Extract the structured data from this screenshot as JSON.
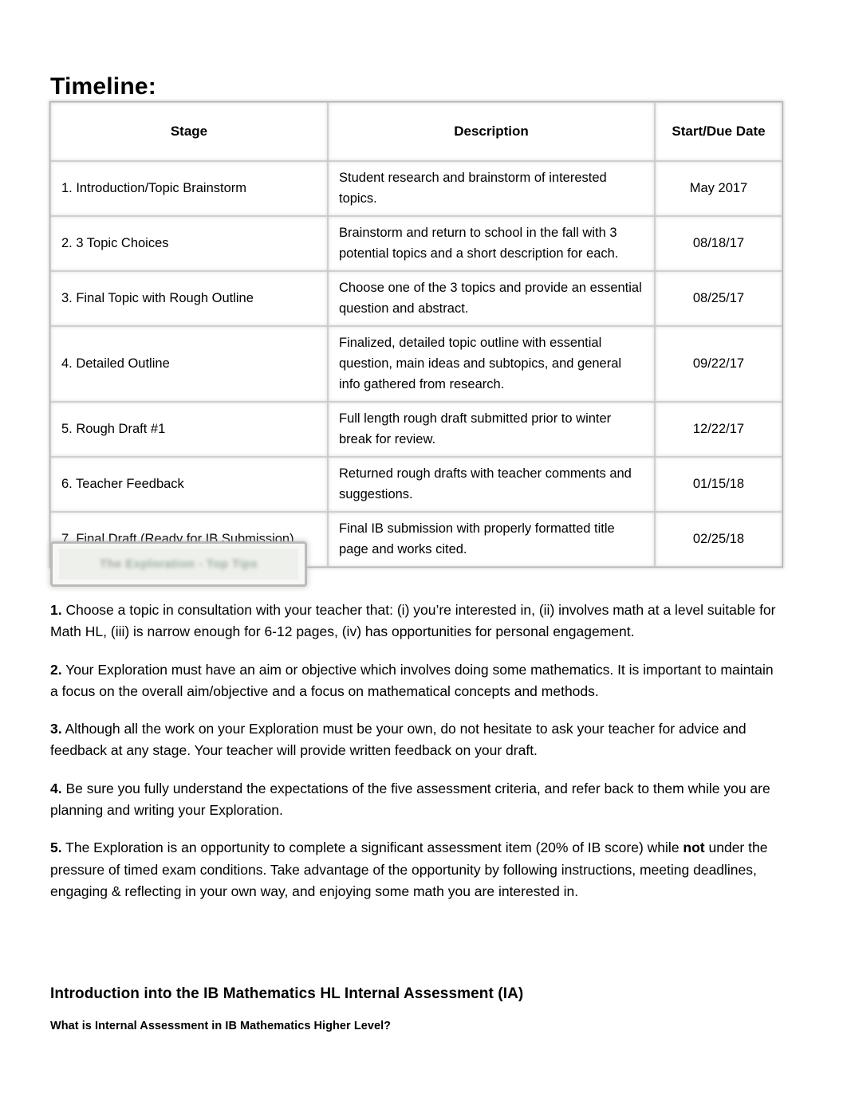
{
  "document": {
    "title": "Timeline:"
  },
  "timeline_table": {
    "headers": [
      "Stage",
      "Description",
      "Start/Due Date"
    ],
    "rows": [
      {
        "stage": "1. Introduction/Topic Brainstorm",
        "description": "Student research and brainstorm of interested topics.",
        "date": "May 2017"
      },
      {
        "stage": "2. 3 Topic Choices",
        "description": "Brainstorm and return to school in the fall with 3 potential topics and a short description for each.",
        "date": "08/18/17"
      },
      {
        "stage": "3. Final Topic with Rough Outline",
        "description": "Choose one of the 3 topics and provide an essential question and abstract.",
        "date": "08/25/17"
      },
      {
        "stage": "4. Detailed Outline",
        "description": "Finalized, detailed topic outline with essential question, main ideas and subtopics, and general info gathered from research.",
        "date": "09/22/17"
      },
      {
        "stage": "5. Rough Draft #1",
        "description": "Full length rough draft submitted prior to winter break for review.",
        "date": "12/22/17"
      },
      {
        "stage": "6. Teacher Feedback",
        "description": "Returned rough drafts with teacher comments and suggestions.",
        "date": "01/15/18"
      },
      {
        "stage": "7. Final Draft (Ready for IB Submission)",
        "description": "Final IB submission with properly formatted title page and works cited.",
        "date": "02/25/18"
      }
    ]
  },
  "tip_banner": {
    "text": "The Exploration - Top Tips",
    "text_color": "#8fa08d",
    "border_color": "#b9bcb9",
    "background_color": "#eef0ec"
  },
  "tips": [
    {
      "number": "1.",
      "parts": [
        {
          "text": " Choose a topic in consultation with your teacher that: (i) you’re interested in, (ii) involves math at a level suitable for Math HL, (iii) is narrow enough for 6-12 pages, (iv) has opportunities for personal engagement.",
          "bold": false
        }
      ]
    },
    {
      "number": "2.",
      "parts": [
        {
          "text": " Your Exploration must have an aim or objective which involves doing some mathematics. It is important to maintain a focus on the overall aim/objective and a focus on mathematical concepts and methods.",
          "bold": false
        }
      ]
    },
    {
      "number": "3.",
      "parts": [
        {
          "text": " Although all the work on your Exploration must be your own, do not hesitate to ask your teacher for advice and feedback at any stage. Your teacher will provide written feedback on your draft.",
          "bold": false
        }
      ]
    },
    {
      "number": "4.",
      "parts": [
        {
          "text": " Be sure you fully understand the expectations of the five assessment criteria, and refer back to them while you are planning and writing your Exploration.",
          "bold": false
        }
      ]
    },
    {
      "number": "5.",
      "parts": [
        {
          "text": " The Exploration is an opportunity to complete a significant assessment item (20% of IB score) while ",
          "bold": false
        },
        {
          "text": "not",
          "bold": true
        },
        {
          "text": " under the pressure of timed exam conditions. Take advantage of the opportunity by following instructions, meeting deadlines, engaging & reflecting in your own way, and enjoying some math you are interested in.",
          "bold": false
        }
      ]
    }
  ],
  "sections": {
    "heading": "Introduction into the IB Mathematics HL Internal Assessment (IA)",
    "subheading": "What is Internal Assessment in IB Mathematics Higher Level?"
  }
}
